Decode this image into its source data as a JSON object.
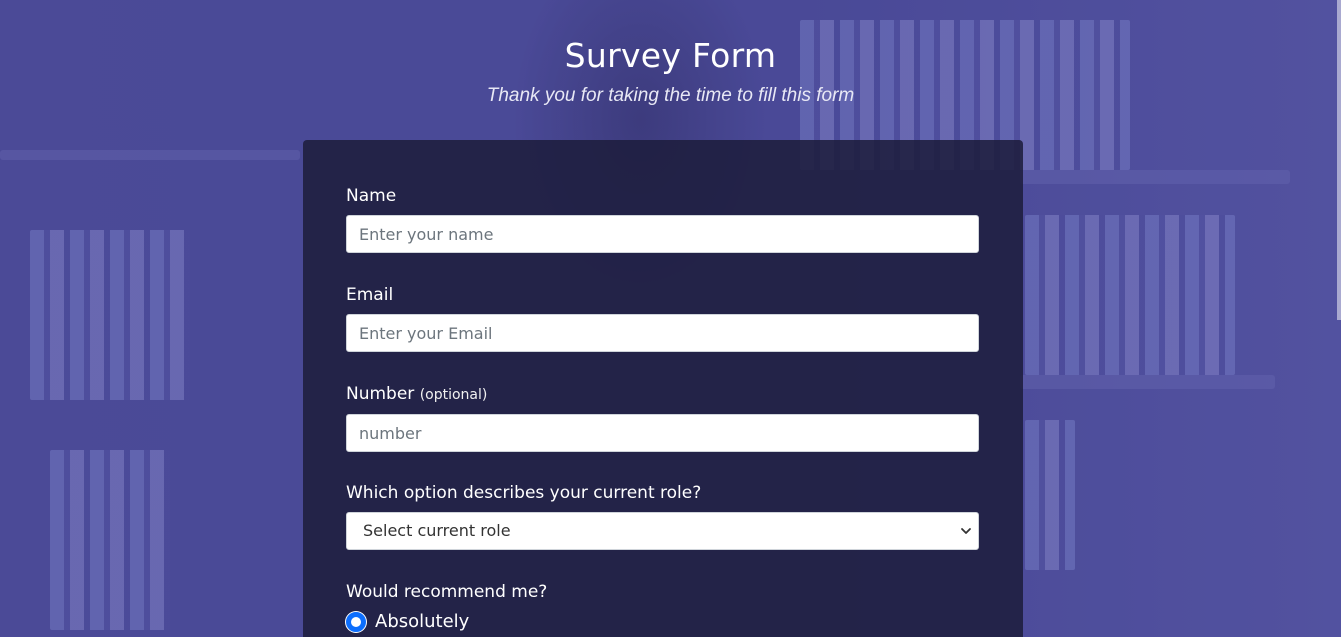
{
  "header": {
    "title": "Survey Form",
    "description": "Thank you for taking the time to fill this form"
  },
  "form": {
    "name": {
      "label": "Name",
      "placeholder": "Enter your name"
    },
    "email": {
      "label": "Email",
      "placeholder": "Enter your Email"
    },
    "number": {
      "label": "Number",
      "optional_note": "(optional)",
      "placeholder": "number"
    },
    "role": {
      "label": "Which option describes your current role?",
      "selected": "Select current role"
    },
    "recommend": {
      "label": "Would recommend me?",
      "options": [
        {
          "label": "Absolutely",
          "checked": true
        }
      ]
    }
  },
  "colors": {
    "background_overlay": "#4f4e99",
    "card": "#1e1e3e",
    "radio_accent": "#0d6efd",
    "text": "#ffffff"
  },
  "icons": {
    "select_arrow": "chevron-down-icon"
  }
}
